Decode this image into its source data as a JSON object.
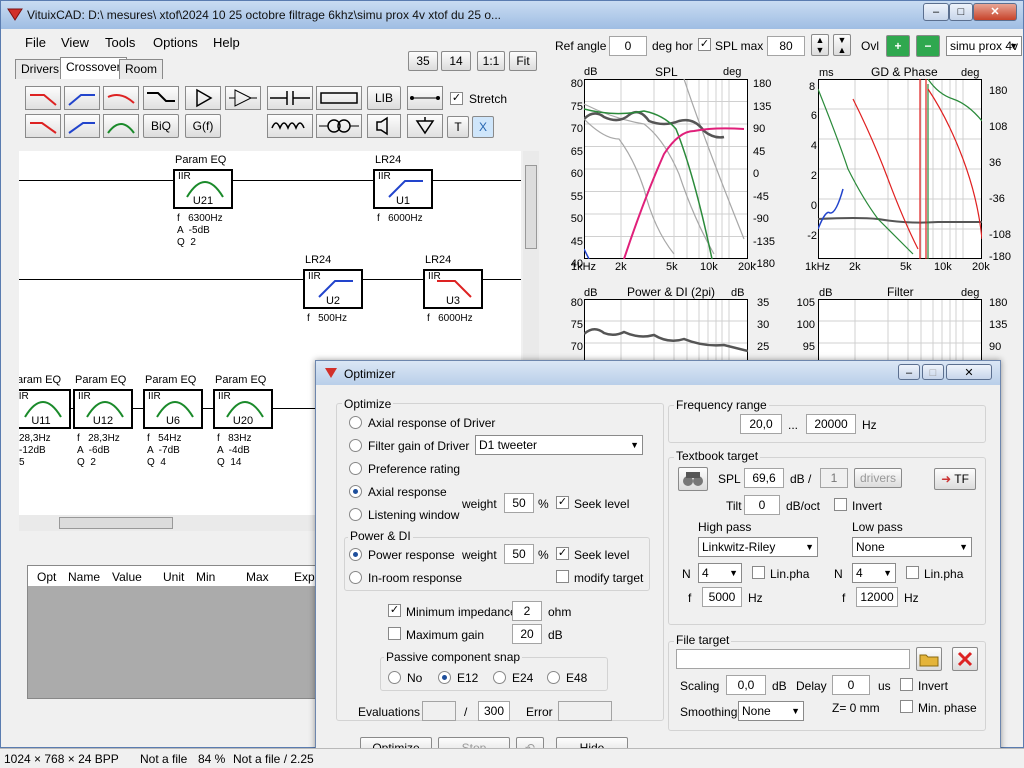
{
  "window": {
    "title": "VituixCAD: D:\\                                   mesures\\                                           xtof\\2024 10 25 octobre filtrage 6khz\\simu  prox 4v xtof du 25 o..."
  },
  "menu": [
    "File",
    "View",
    "Tools",
    "Options",
    "Help"
  ],
  "tabs": [
    "Drivers",
    "Crossover",
    "Room"
  ],
  "view_controls": {
    "a": "35",
    "b": "14",
    "one": "1:1",
    "fit": "Fit"
  },
  "toolbar": {
    "lib": "LIB",
    "stretch": "Stretch",
    "biq": "BiQ",
    "gf": "G(f)",
    "t": "T",
    "x": "X"
  },
  "top_controls": {
    "ref_angle_label": "Ref angle",
    "ref_angle": "0",
    "deg_hor": "deg hor",
    "spl_max_label": "SPL max",
    "spl_max": "80",
    "ovl": "Ovl",
    "sim_name": "simu  prox 4v x"
  },
  "blocks": [
    {
      "name": "Param EQ",
      "id": "U21",
      "info": "f   6300Hz\nA  -5dB\nQ  2"
    },
    {
      "name": "LR24",
      "id": "U1",
      "info": "f   6000Hz"
    },
    {
      "name": "LR24",
      "id": "U2",
      "info": "f   500Hz"
    },
    {
      "name": "LR24",
      "id": "U3",
      "info": "f   6000Hz"
    },
    {
      "name": "aram EQ",
      "id": "U11",
      "info": "28,3Hz\n-12dB\n5"
    },
    {
      "name": "Param EQ",
      "id": "U12",
      "info": "f   28,3Hz\nA  -6dB\nQ  2"
    },
    {
      "name": "Param EQ",
      "id": "U6",
      "info": "f   54Hz\nA  -7dB\nQ  4"
    },
    {
      "name": "Param EQ",
      "id": "U20",
      "info": "f   83Hz\nA  -4dB\nQ  14"
    }
  ],
  "iir": "IIR",
  "table_headers": [
    "Opt",
    "Name",
    "Value",
    "Unit",
    "Min",
    "Max",
    "Expr"
  ],
  "graphs": {
    "spl": {
      "title": "SPL",
      "left_unit": "dB",
      "right_unit": "deg",
      "left_ticks": [
        "80",
        "75",
        "70",
        "65",
        "60",
        "55",
        "50",
        "45",
        "40"
      ],
      "right_ticks": [
        "180",
        "135",
        "90",
        "45",
        "0",
        "-45",
        "-90",
        "-135",
        "-180"
      ],
      "x_ticks": [
        "1kHz",
        "2k",
        "5k",
        "10k",
        "20k"
      ]
    },
    "gd": {
      "title": "GD & Phase",
      "left_unit": "ms",
      "right_unit": "deg",
      "left_ticks": [
        "8",
        "6",
        "4",
        "2",
        "0",
        "-2"
      ],
      "right_ticks": [
        "180",
        "108",
        "36",
        "-36",
        "-108",
        "-180"
      ],
      "x_ticks": [
        "1kHz",
        "2k",
        "5k",
        "10k",
        "20k"
      ]
    },
    "power": {
      "title": "Power & DI (2pi)",
      "left_unit": "dB",
      "right_unit": "dB",
      "left_ticks": [
        "80",
        "75",
        "70"
      ],
      "right_ticks": [
        "35",
        "30",
        "25"
      ]
    },
    "filter": {
      "title": "Filter",
      "left_unit": "dB",
      "right_unit": "deg",
      "left_ticks": [
        "105",
        "100",
        "95"
      ],
      "right_ticks": [
        "180",
        "135",
        "90"
      ]
    }
  },
  "optimizer": {
    "title": "Optimizer",
    "optimize_group": "Optimize",
    "opt_axial_driver": "Axial response of Driver",
    "opt_filter_gain": "Filter gain of Driver",
    "driver_select": "D1 tweeter",
    "opt_pref": "Preference rating",
    "opt_axial": "Axial response",
    "opt_listen": "Listening window",
    "weight_label": "weight",
    "weight1": "50",
    "pct": "%",
    "seek_level": "Seek level",
    "power_group": "Power & DI",
    "opt_power": "Power response",
    "weight2": "50",
    "opt_inroom": "In-room response",
    "modify_target": "modify target",
    "min_imp": "Minimum impedance",
    "min_imp_val": "2",
    "ohm": "ohm",
    "max_gain": "Maximum gain",
    "max_gain_val": "20",
    "db": "dB",
    "snap_group": "Passive component snap",
    "snap_no": "No",
    "snap_e12": "E12",
    "snap_e24": "E24",
    "snap_e48": "E48",
    "evaluations": "Evaluations",
    "eval_total": "300",
    "slash": "/",
    "error": "Error",
    "btn_optimize": "Optimize",
    "btn_stop": "Stop",
    "btn_hide": "Hide",
    "freq_group": "Frequency range",
    "freq_lo": "20,0",
    "ellipsis": "...",
    "freq_hi": "20000",
    "hz": "Hz",
    "textbook_group": "Textbook target",
    "spl_label": "SPL",
    "spl_val": "69,6",
    "db_slash": "dB /",
    "drivers_n": "1",
    "drivers": "drivers",
    "tf": "TF",
    "tilt_label": "Tilt",
    "tilt_val": "0",
    "db_oct": "dB/oct",
    "invert": "Invert",
    "high_pass": "High pass",
    "hp_type": "Linkwitz-Riley",
    "low_pass": "Low pass",
    "lp_type": "None",
    "n_label": "N",
    "hp_n": "4",
    "lp_n": "4",
    "linpha": "Lin.pha",
    "f_label": "f",
    "hp_f": "5000",
    "lp_f": "12000",
    "file_group": "File target",
    "scaling": "Scaling",
    "scaling_val": "0,0",
    "delay": "Delay",
    "delay_val": "0",
    "us": "us",
    "smoothing": "Smoothing",
    "smoothing_val": "None",
    "z_info": "Z= 0 mm",
    "min_phase": "Min. phase"
  },
  "statusbar": {
    "res": "1024 × 768 × 24 BPP",
    "file": "Not a file",
    "zoom": "84 %",
    "file2": "Not a file / 2.25"
  }
}
